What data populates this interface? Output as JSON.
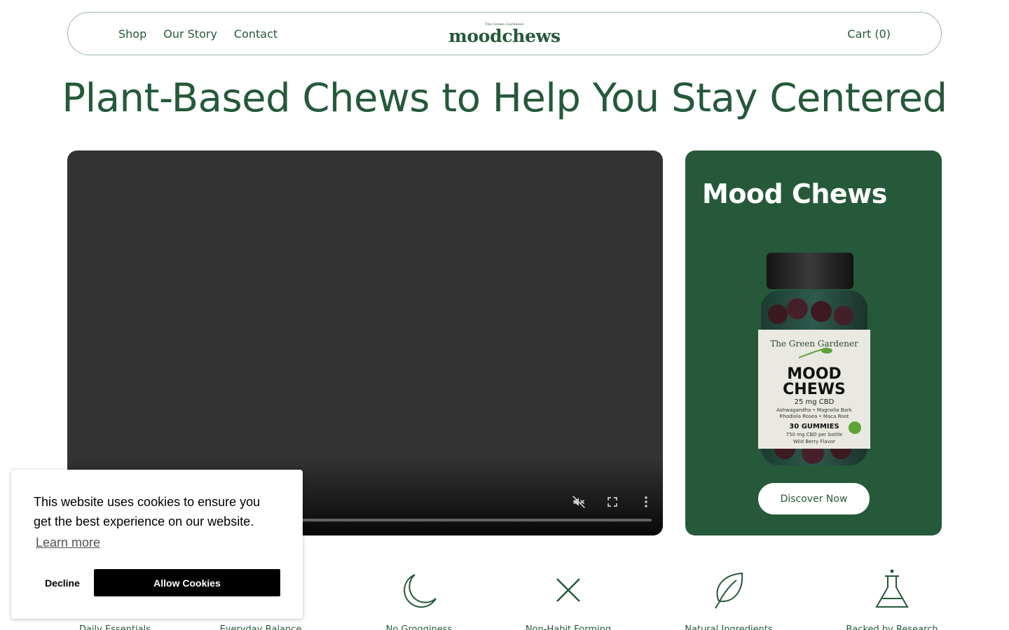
{
  "nav": {
    "links": [
      "Shop",
      "Our Story",
      "Contact"
    ],
    "logo_small": "The Green Gardener",
    "logo_main": "moodchews",
    "cart": "Cart (0)"
  },
  "hero": {
    "title": "Plant-Based Chews to Help You Stay Centered"
  },
  "video": {
    "controls": [
      "mute-icon",
      "fullscreen-icon",
      "more-icon"
    ]
  },
  "promo": {
    "title": "Mood Chews",
    "button": "Discover Now",
    "bottle": {
      "brand": "The Green Gardener",
      "line1": "MOOD",
      "line2": "CHEWS",
      "dose": "25 mg CBD",
      "ingredients1": "Ashwagandha • Magnolia Bark",
      "ingredients2": "Rhodiola Rosea • Maca Root",
      "count": "30 GUMMIES",
      "total": "750 mg CBD per bottle",
      "flavor": "Wild Berry Flavor"
    }
  },
  "features": [
    {
      "icon": "moon-icon",
      "label": "No Grogginess"
    },
    {
      "icon": "x-icon",
      "label": "Non-Habit Forming"
    },
    {
      "icon": "leaf-icon",
      "label": "Natural Ingredients"
    },
    {
      "icon": "flask-icon",
      "label": "Backed by Research"
    }
  ],
  "features_hidden_left": [
    {
      "label": "Daily Essentials"
    },
    {
      "label": "Everyday Balance"
    }
  ],
  "cookie": {
    "message": "This website uses cookies to ensure you get the best experience on our website.",
    "learn_more": "Learn more",
    "decline": "Decline",
    "allow": "Allow Cookies"
  },
  "colors": {
    "brand_green": "#25593a",
    "video_bg": "#333333"
  }
}
